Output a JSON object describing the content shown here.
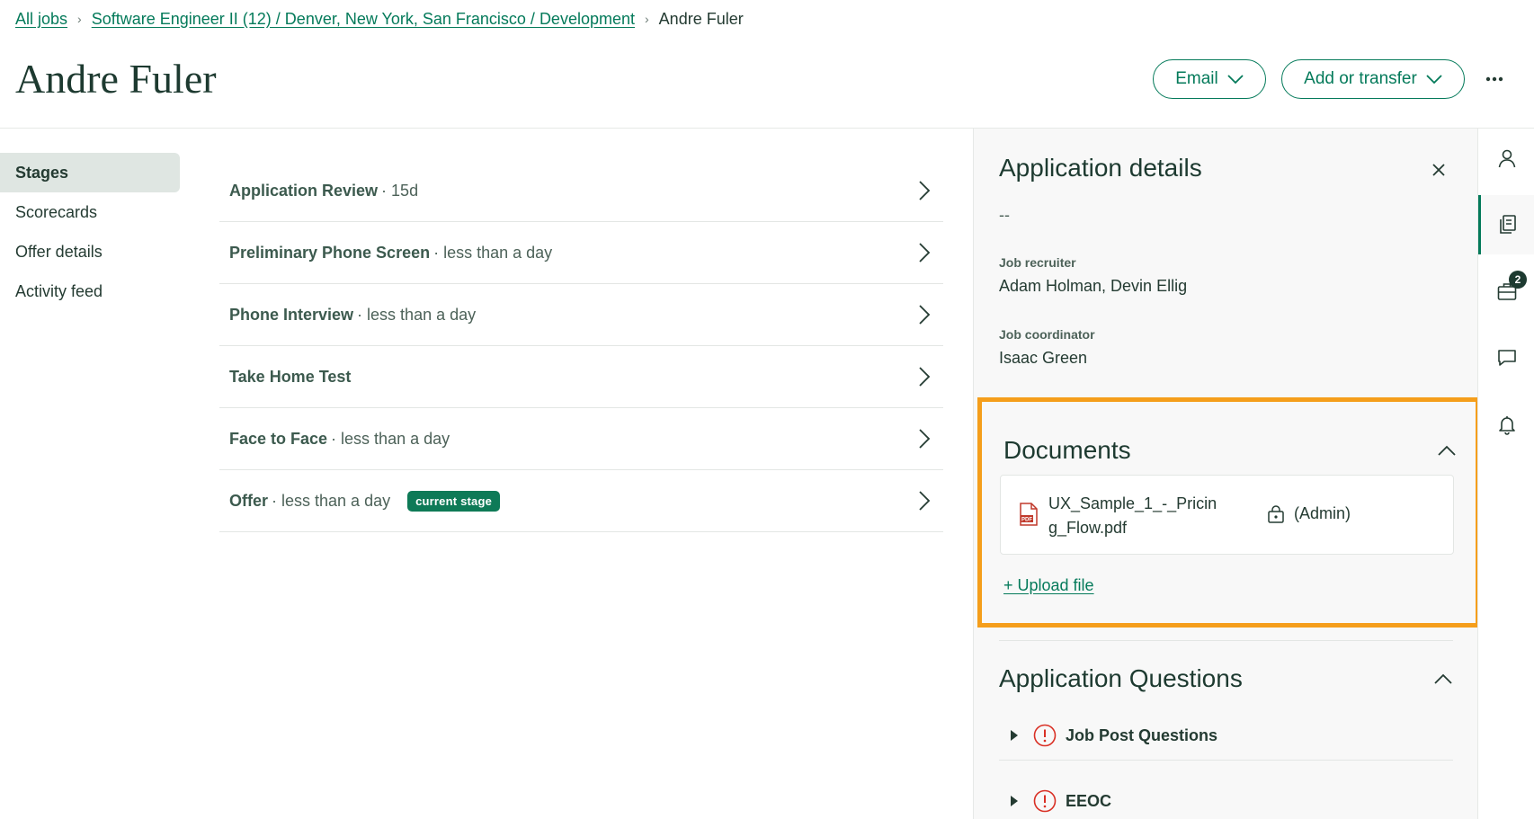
{
  "breadcrumb": {
    "root": "All jobs",
    "job": "Software Engineer II (12) / Denver, New York, San Francisco / Development",
    "current": "Andre Fuler"
  },
  "candidate": {
    "name": "Andre Fuler"
  },
  "header": {
    "email_label": "Email",
    "add_transfer_label": "Add or transfer",
    "more_icon": "more-horizontal-icon"
  },
  "nav": {
    "items": [
      {
        "label": "Stages",
        "active": true
      },
      {
        "label": "Scorecards",
        "active": false
      },
      {
        "label": "Offer details",
        "active": false
      },
      {
        "label": "Activity feed",
        "active": false
      }
    ]
  },
  "stages": [
    {
      "name": "Application Review",
      "duration": "· 15d"
    },
    {
      "name": "Preliminary Phone Screen",
      "duration": "· less than a day"
    },
    {
      "name": "Phone Interview",
      "duration": "· less than a day"
    },
    {
      "name": "Take Home Test",
      "duration": ""
    },
    {
      "name": "Face to Face",
      "duration": "· less than a day"
    },
    {
      "name": "Offer",
      "duration": "· less than a day",
      "badge": "current stage"
    }
  ],
  "application_details": {
    "title": "Application details",
    "summary": "--",
    "recruiter_label": "Job recruiter",
    "recruiter_value": "Adam Holman, Devin Ellig",
    "coordinator_label": "Job coordinator",
    "coordinator_value": "Isaac Green",
    "documents": {
      "title": "Documents",
      "file_name": "UX_Sample_1_-_Pricing_Flow.pdf",
      "access": "(Admin)",
      "upload_label": "+ Upload file"
    },
    "questions": {
      "title": "Application Questions",
      "items": [
        {
          "label": "Job Post Questions"
        },
        {
          "label": "EEOC"
        }
      ]
    }
  },
  "rail": {
    "jobs_badge": "2"
  },
  "colors": {
    "accent": "#047a5a",
    "highlight": "#f59e1b",
    "badge": "#0e7a57",
    "warning": "#d93025"
  }
}
